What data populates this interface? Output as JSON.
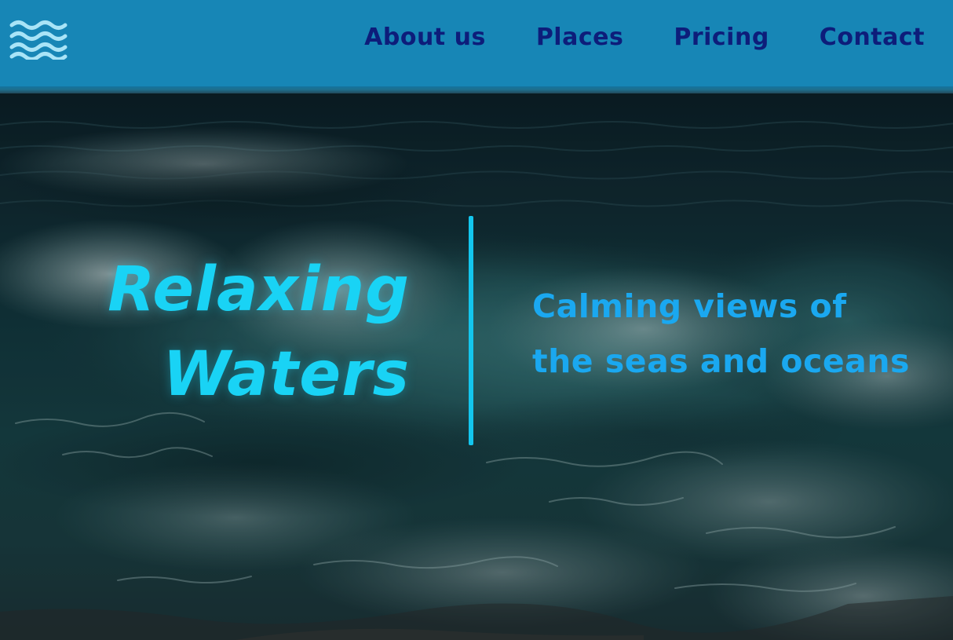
{
  "header": {
    "logo_icon": "waves-icon",
    "background_color": "#1786b6",
    "nav": [
      {
        "label": "About us"
      },
      {
        "label": "Places"
      },
      {
        "label": "Pricing"
      },
      {
        "label": "Contact"
      }
    ],
    "nav_color": "#0d1d7a"
  },
  "hero": {
    "background_image": "ocean-waves-photo",
    "title_line1": "Relaxing",
    "title_line2": "Waters",
    "tagline_line1": "Calming views of",
    "tagline_line2": "the seas and oceans",
    "title_color": "#19d3f5",
    "tagline_color": "#1aa8f0",
    "divider_color": "#13c6ee"
  }
}
